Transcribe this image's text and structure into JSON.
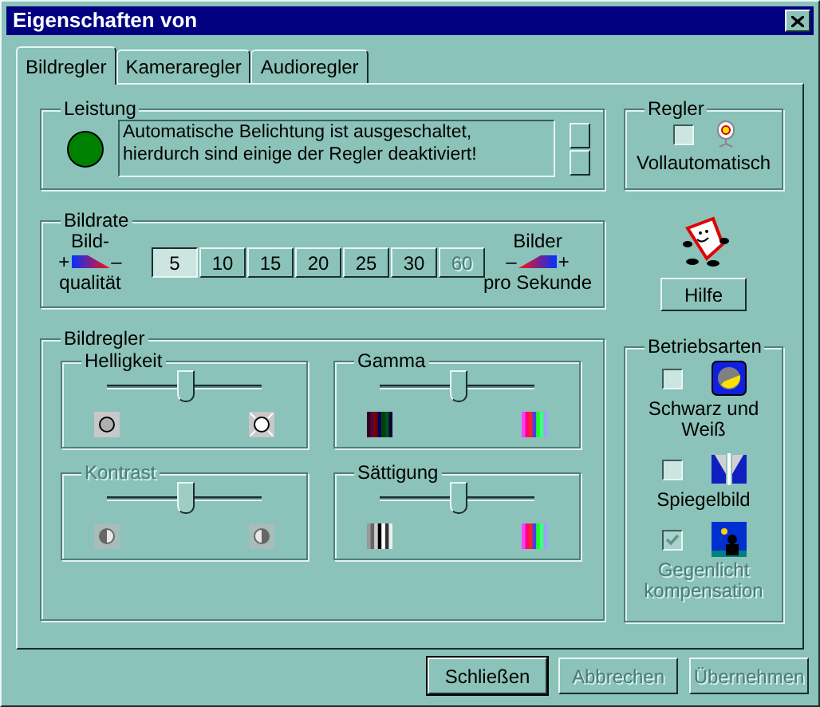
{
  "window": {
    "title": "Eigenschaften von"
  },
  "tabs": [
    {
      "label": "Bildregler",
      "selected": true
    },
    {
      "label": "Kameraregler",
      "selected": false
    },
    {
      "label": "Audioregler",
      "selected": false
    }
  ],
  "leistung": {
    "title": "Leistung",
    "status_light_on": true,
    "message": "Automatische Belichtung ist ausgeschaltet, hierdurch sind einige der Regler deaktiviert!"
  },
  "regler": {
    "title": "Regler",
    "checked": false,
    "label": "Vollautomatisch"
  },
  "bildrate": {
    "title": "Bildrate",
    "left": {
      "top": "Bild-",
      "plus": "+",
      "minus": "–",
      "bottom": "qualität"
    },
    "rates": [
      {
        "label": "5",
        "selected": true,
        "disabled": false
      },
      {
        "label": "10",
        "selected": false,
        "disabled": false
      },
      {
        "label": "15",
        "selected": false,
        "disabled": false
      },
      {
        "label": "20",
        "selected": false,
        "disabled": false
      },
      {
        "label": "25",
        "selected": false,
        "disabled": false
      },
      {
        "label": "30",
        "selected": false,
        "disabled": false
      },
      {
        "label": "60",
        "selected": false,
        "disabled": true
      }
    ],
    "right": {
      "top": "Bilder",
      "minus": "–",
      "plus": "+",
      "bottom": "pro Sekunde"
    }
  },
  "help_button": "Hilfe",
  "bildregler": {
    "title": "Bildregler",
    "sliders": [
      {
        "kind": "brightness",
        "label": "Helligkeit",
        "disabled": false,
        "level": 0.51
      },
      {
        "kind": "gamma",
        "label": "Gamma",
        "disabled": false,
        "level": 0.5
      },
      {
        "kind": "contrast",
        "label": "Kontrast",
        "disabled": true,
        "level": 0.51
      },
      {
        "kind": "saturation",
        "label": "Sättigung",
        "disabled": false,
        "level": 0.5
      }
    ]
  },
  "betriebsarten": {
    "title": "Betriebsarten",
    "modes": [
      {
        "kind": "bw",
        "label": "Schwarz und Weiß",
        "checked": false,
        "disabled": false
      },
      {
        "kind": "mirror",
        "label": "Spiegelbild",
        "checked": false,
        "disabled": false
      },
      {
        "kind": "backlight",
        "label": "Gegenlicht kompensation",
        "checked": true,
        "disabled": true
      }
    ]
  },
  "buttons": [
    {
      "label": "Schließen",
      "default": true,
      "disabled": false
    },
    {
      "label": "Abbrechen",
      "default": false,
      "disabled": true
    },
    {
      "label": "Übernehmen",
      "default": false,
      "disabled": true
    }
  ]
}
